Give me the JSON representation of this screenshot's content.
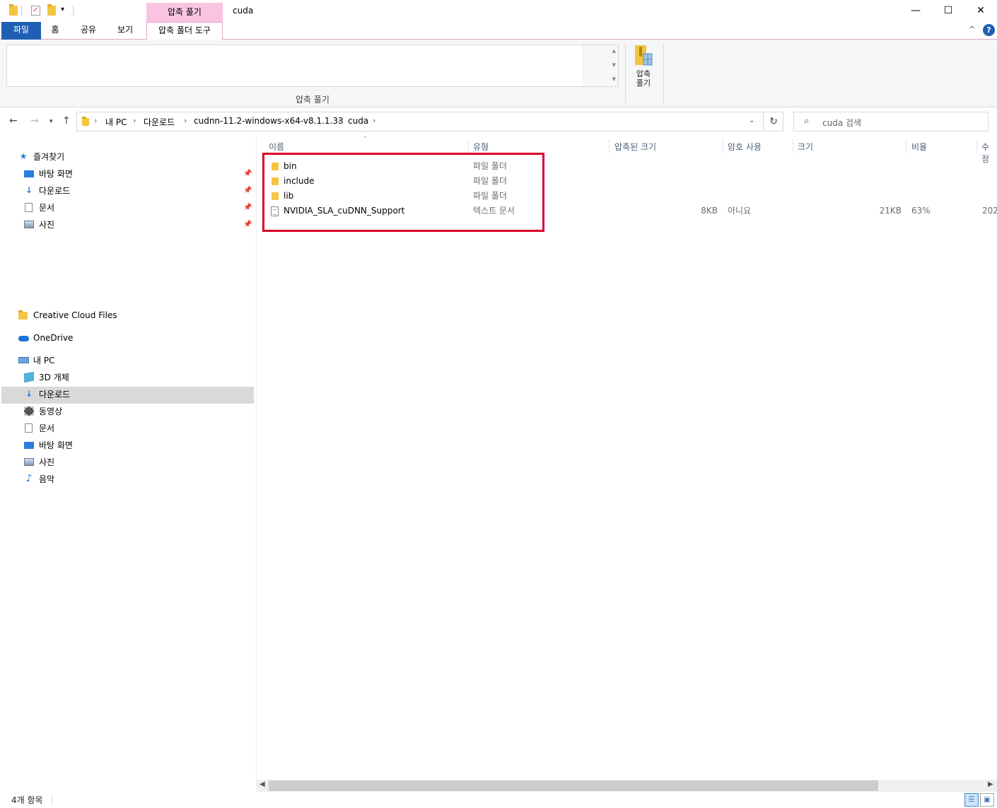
{
  "window": {
    "title": "cuda",
    "context_tab": "압축 풀기",
    "minimize_glyph": "—",
    "maximize_glyph": "☐",
    "close_glyph": "✕"
  },
  "ribbon": {
    "tabs": [
      "파일",
      "홈",
      "공유",
      "보기",
      "압축 폴더 도구"
    ],
    "group_label": "압축 풀기",
    "extract_all_label": "압축\n풀기",
    "help_glyph": "?",
    "collapse_glyph": "^"
  },
  "address": {
    "crumbs": [
      "내 PC",
      "다운로드",
      "cudnn-11.2-windows-x64-v8.1.1.33",
      "cuda"
    ],
    "search_placeholder": "cuda 검색"
  },
  "navpane": {
    "quick_access": {
      "label": "즐겨찾기",
      "items": [
        {
          "label": "바탕 화면",
          "icon": "desktop-icon"
        },
        {
          "label": "다운로드",
          "icon": "download-icon"
        },
        {
          "label": "문서",
          "icon": "document-icon"
        },
        {
          "label": "사진",
          "icon": "pictures-icon"
        }
      ]
    },
    "creative_cloud": "Creative Cloud Files",
    "onedrive": "OneDrive",
    "this_pc": {
      "label": "내 PC",
      "items": [
        {
          "label": "3D 개체",
          "icon": "3d-objects-icon"
        },
        {
          "label": "다운로드",
          "icon": "download-icon",
          "selected": true
        },
        {
          "label": "동영상",
          "icon": "video-icon"
        },
        {
          "label": "문서",
          "icon": "document-icon"
        },
        {
          "label": "바탕 화면",
          "icon": "desktop-icon"
        },
        {
          "label": "사진",
          "icon": "pictures-icon"
        },
        {
          "label": "음악",
          "icon": "music-icon"
        }
      ]
    }
  },
  "filelist": {
    "columns": [
      "이름",
      "유형",
      "압축된 크기",
      "암호 사용",
      "크기",
      "비율",
      "수정"
    ],
    "rows": [
      {
        "name": "bin",
        "type": "파일 폴더",
        "compressed": "",
        "password": "",
        "size": "",
        "ratio": "",
        "modified": "",
        "icon": "folder-icon"
      },
      {
        "name": "include",
        "type": "파일 폴더",
        "compressed": "",
        "password": "",
        "size": "",
        "ratio": "",
        "modified": "",
        "icon": "folder-icon"
      },
      {
        "name": "lib",
        "type": "파일 폴더",
        "compressed": "",
        "password": "",
        "size": "",
        "ratio": "",
        "modified": "",
        "icon": "folder-icon"
      },
      {
        "name": "NVIDIA_SLA_cuDNN_Support",
        "type": "텍스트 문서",
        "compressed": "8KB",
        "password": "아니요",
        "size": "21KB",
        "ratio": "63%",
        "modified": "202",
        "icon": "text-file-icon"
      }
    ]
  },
  "status": {
    "item_count": "4개 항목"
  },
  "colors": {
    "file_tab": "#1e5fb4",
    "context_tab": "#f9c4e1",
    "highlight_box": "#d9002d",
    "selection": "#d9d9d9"
  }
}
